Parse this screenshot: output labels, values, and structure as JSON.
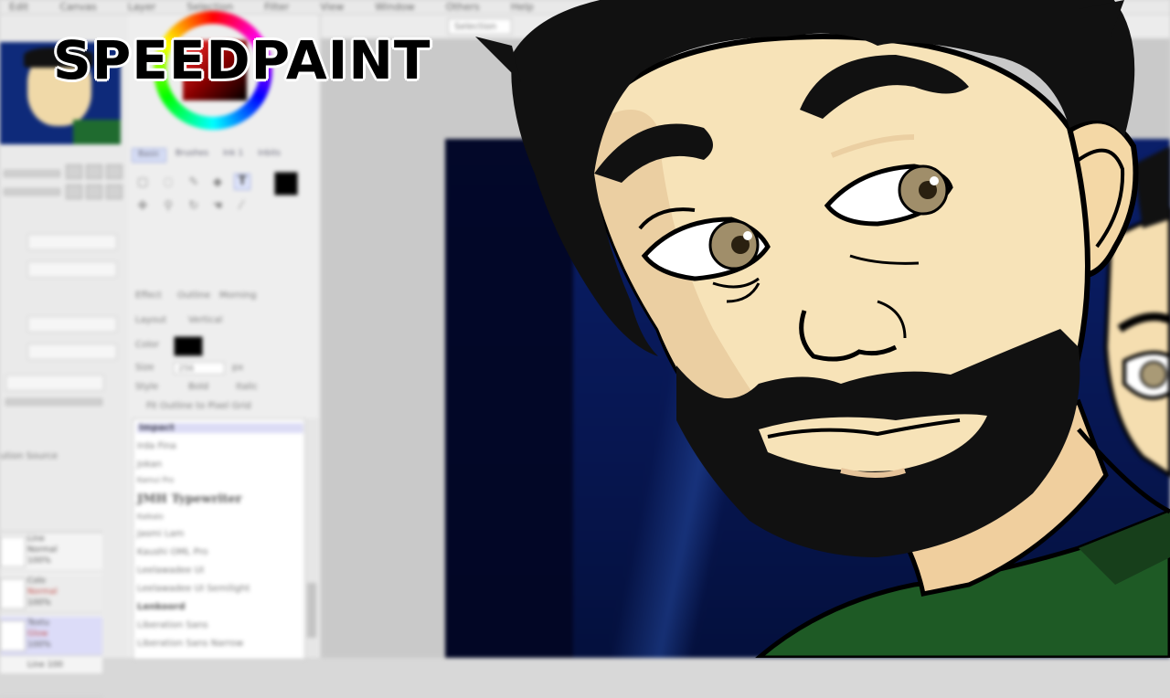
{
  "title": "SPEEDPAINT",
  "menubar": {
    "items": [
      "Edit",
      "Canvas",
      "Layer",
      "Selection",
      "Filter",
      "View",
      "Window",
      "Others",
      "Help"
    ]
  },
  "toolbar": {
    "selection_label": "Selection"
  },
  "tool_panel": {
    "tabs": [
      "Basic",
      "Brushes",
      "Ink 1",
      "Inbits"
    ],
    "active_tab": "Basic",
    "active_tool": "T",
    "labels": {
      "layout": "Layout",
      "layout_value": "Vertical",
      "color": "Color",
      "size": "Size",
      "size_value": "256",
      "size_unit": "px",
      "style": "Style",
      "style_bold": "Bold",
      "style_italic": "Italic",
      "fit_outline": "Fit Outline to Pixel Grid",
      "effect": "Effect",
      "outline": "Outline",
      "morning": "Morning"
    },
    "text_color": "#000000",
    "main_color": "#000000"
  },
  "font_list": {
    "items": [
      {
        "name": "Impact",
        "style": "selected"
      },
      {
        "name": "Irda Fina",
        "style": "normal"
      },
      {
        "name": "Jokan",
        "style": "normal"
      },
      {
        "name": "Kamui Pro",
        "style": "normal"
      },
      {
        "name": "JMH Typewriter",
        "style": "serif"
      },
      {
        "name": "Kalkalo",
        "style": "normal"
      },
      {
        "name": "Jasmi Lam",
        "style": "normal"
      },
      {
        "name": "Kaushi OML Pro",
        "style": "normal"
      },
      {
        "name": "Leelawadee UI",
        "style": "normal"
      },
      {
        "name": "Leelawadee UI Semilight",
        "style": "normal"
      },
      {
        "name": "Lenkoord",
        "style": "bold"
      },
      {
        "name": "Liberation Sans",
        "style": "normal"
      },
      {
        "name": "Liberation Sans Narrow",
        "style": "normal"
      }
    ]
  },
  "left_panel": {
    "source_label": "ution Source",
    "layers": [
      {
        "name": "Line",
        "mode": "Normal",
        "opacity": "100%"
      },
      {
        "name": "Colo",
        "mode": "Normal",
        "opacity": "100%"
      },
      {
        "name": "Textu",
        "mode": "Glow",
        "opacity": "100%"
      },
      {
        "name": "Line 100",
        "mode": "",
        "opacity": ""
      }
    ]
  },
  "colors": {
    "canvas_dark": "#04103d",
    "canvas_blue": "#0a1f6a",
    "skin": "#f7e3b8",
    "skin_shadow": "#e8c497",
    "hair": "#111111",
    "iris": "#a08e6a",
    "shirt": "#1e5a25"
  }
}
